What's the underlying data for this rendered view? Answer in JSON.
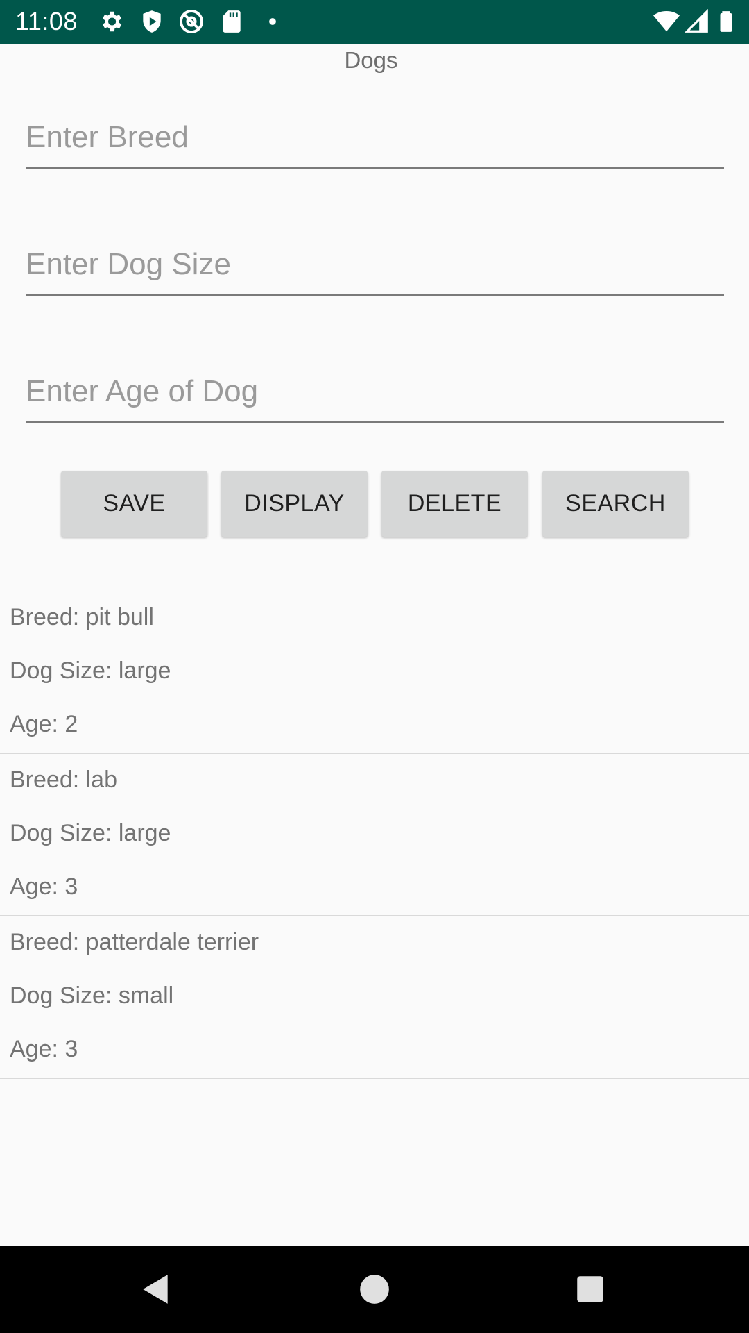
{
  "status_bar": {
    "time": "11:08",
    "icons": [
      "gear-icon",
      "shield-icon",
      "at-sign-icon",
      "sd-card-icon",
      "dot-icon",
      "wifi-icon",
      "signal-icon",
      "battery-icon"
    ]
  },
  "app": {
    "title": "Dogs",
    "fields": {
      "breed_placeholder": "Enter Breed",
      "size_placeholder": "Enter Dog Size",
      "age_placeholder": "Enter Age of Dog"
    },
    "buttons": {
      "save": "SAVE",
      "display": "DISPLAY",
      "delete": "DELETE",
      "search": "SEARCH"
    },
    "records": [
      {
        "breed": "Breed: pit bull",
        "size": "Dog Size: large",
        "age": "Age: 2"
      },
      {
        "breed": "Breed: lab",
        "size": "Dog Size: large",
        "age": "Age: 3"
      },
      {
        "breed": "Breed: patterdale terrier",
        "size": "Dog Size: small",
        "age": "Age: 3"
      }
    ]
  },
  "nav_bar": {
    "icons": [
      "back-icon",
      "home-icon",
      "recents-icon"
    ]
  },
  "colors": {
    "status_bar": "#00574b",
    "background": "#fafafa",
    "button": "#d6d7d7",
    "text_secondary": "#737373"
  }
}
